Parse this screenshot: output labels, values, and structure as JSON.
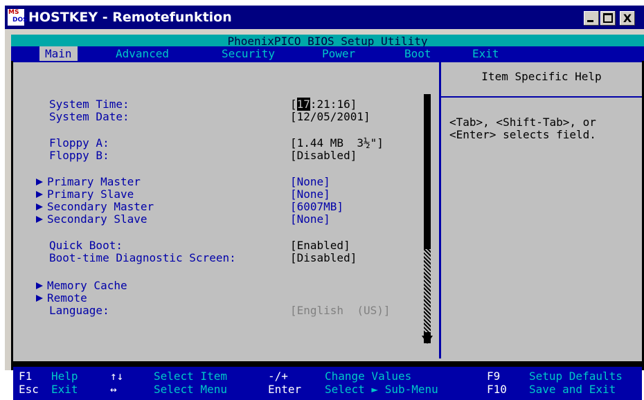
{
  "window": {
    "title": "HOSTKEY - Remotefunktion",
    "icon_letters_top": "MS",
    "icon_letters_bottom": "DOS",
    "close_label": "X"
  },
  "bios": {
    "utility_title": "PhoenixPICO BIOS Setup Utility",
    "menu": [
      {
        "label": "Main",
        "active": true
      },
      {
        "label": "Advanced",
        "active": false
      },
      {
        "label": "Security",
        "active": false
      },
      {
        "label": "Power",
        "active": false
      },
      {
        "label": "Boot",
        "active": false
      },
      {
        "label": "Exit",
        "active": false
      }
    ],
    "settings": {
      "system_time": {
        "label": "System Time:",
        "cursor_value": "17",
        "rest_value": ":21:16]"
      },
      "system_date": {
        "label": "System Date:",
        "value": "[12/05/2001]"
      },
      "floppy_a": {
        "label": "Floppy A:",
        "value": "[1.44 MB  3½\"]"
      },
      "floppy_b": {
        "label": "Floppy B:",
        "value": "[Disabled]"
      },
      "primary_master": {
        "label": "Primary Master",
        "value": "[None]"
      },
      "primary_slave": {
        "label": "Primary Slave",
        "value": "[None]"
      },
      "secondary_master": {
        "label": "Secondary Master",
        "value": "[6007MB]"
      },
      "secondary_slave": {
        "label": "Secondary Slave",
        "value": "[None]"
      },
      "quick_boot": {
        "label": "Quick Boot:",
        "value": "[Enabled]"
      },
      "diag_screen": {
        "label": "Boot-time Diagnostic Screen:",
        "value": "[Disabled]"
      },
      "memory_cache": {
        "label": "Memory Cache"
      },
      "remote": {
        "label": "Remote"
      },
      "language": {
        "label": "Language:",
        "value": "[English  (US)]"
      }
    },
    "help": {
      "title": "Item Specific Help",
      "text": "<Tab>, <Shift-Tab>, or\n<Enter> selects field."
    },
    "status": {
      "f1": "F1",
      "help": "Help",
      "updown": "↑↓",
      "select_item": "Select Item",
      "minusplus": "-/+",
      "change_values": "Change Values",
      "f9": "F9",
      "setup_defaults": "Setup Defaults",
      "esc": "Esc",
      "exit": "Exit",
      "leftright": "↔",
      "select_menu": "Select Menu",
      "enter": "Enter",
      "select_submenu": "Select ► Sub-Menu",
      "f10": "F10",
      "save_exit": "Save and Exit"
    }
  },
  "colors": {
    "titlebar": "#000080",
    "bios_blue": "#0000a8",
    "bios_cyan": "#00a8a8",
    "panel_gray": "#c0c0c0"
  }
}
